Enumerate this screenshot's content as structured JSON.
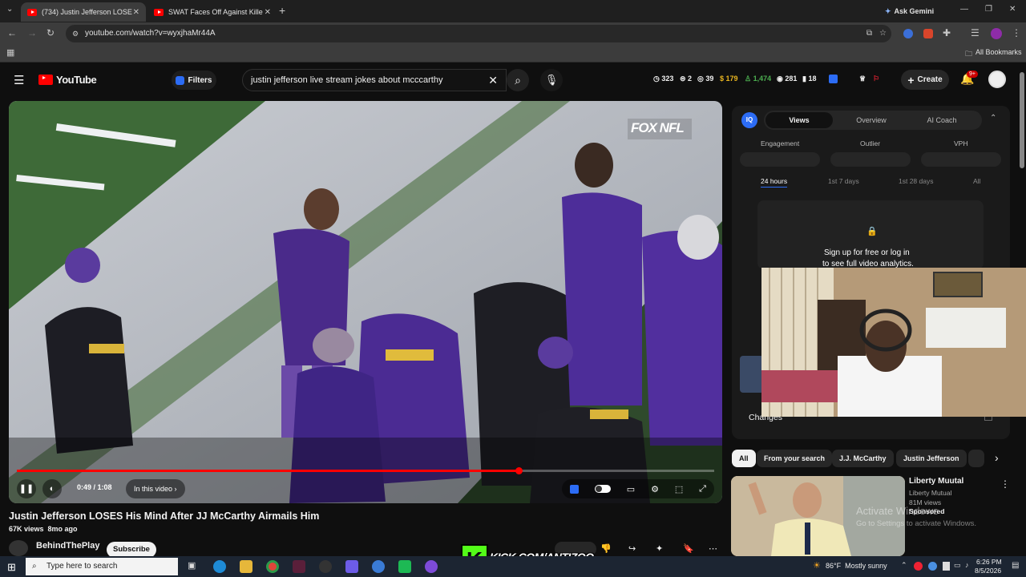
{
  "browser": {
    "tabs": [
      {
        "title": "(734) Justin Jefferson LOSE",
        "active": true
      },
      {
        "title": "SWAT Faces Off Against Killer &",
        "active": false
      }
    ],
    "ask_gemini": "Ask Gemini",
    "url": "youtube.com/watch?v=wyxjhaMr44A",
    "all_bookmarks": "All Bookmarks"
  },
  "youtube": {
    "logo_text": "YouTube",
    "filters_label": "Filters",
    "search_query": "justin jefferson live stream jokes about mcccarthy",
    "stats": [
      "323",
      "2",
      "39",
      "179",
      "1,474",
      "281",
      "18"
    ],
    "create_label": "Create",
    "notif_badge": "9+"
  },
  "video": {
    "overlay_logo": "FOX NFL",
    "time": "0:49 / 1:08",
    "in_this_video": "In this video",
    "progress": 0.72,
    "title": "Justin Jefferson LOSES His Mind After JJ McCarthy Airmails Him",
    "views_line": "67K views  8mo ago",
    "channel": "BehindThePlay",
    "subscribe": "Subscribe"
  },
  "vidiq": {
    "tabs": [
      "Views",
      "Overview",
      "AI Coach"
    ],
    "metrics": [
      "Engagement",
      "Outlier",
      "VPH"
    ],
    "ranges": [
      "24 hours",
      "1st 7 days",
      "1st 28 days",
      "All"
    ],
    "signup_line1": "Sign up for free or log in",
    "signup_line2": "to see full video analytics.",
    "changes": "Changes"
  },
  "chips": [
    "All",
    "From your search",
    "J.J. McCarthy",
    "Justin Jefferson"
  ],
  "ad": {
    "title": "Liberty Muutal",
    "advertiser": "Liberty Mutual",
    "views": "81M views",
    "sponsored": "Sponsored"
  },
  "windows_activate": {
    "line1": "Activate Windows",
    "line2": "Go to Settings to activate Windows."
  },
  "overlay_banner": "KICK.COM/ANTIZOO",
  "taskbar": {
    "search_placeholder": "Type here to search",
    "weather": "86°F  Mostly sunny",
    "time": "6:26 PM",
    "date": "8/5/2026"
  }
}
